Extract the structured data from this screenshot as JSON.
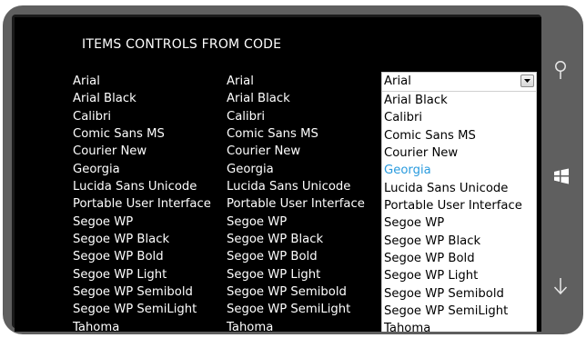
{
  "page_title": "ITEMS CONTROLS FROM CODE",
  "fonts": [
    "Arial",
    "Arial Black",
    "Calibri",
    "Comic Sans MS",
    "Courier New",
    "Georgia",
    "Lucida Sans Unicode",
    "Portable User Interface",
    "Segoe WP",
    "Segoe WP Black",
    "Segoe WP Bold",
    "Segoe WP Light",
    "Segoe WP Semibold",
    "Segoe WP SemiLight",
    "Tahoma"
  ],
  "combo": {
    "selected_value": "Arial",
    "highlighted_item": "Georgia",
    "highlight_color": "#2a9bde"
  },
  "icons": {
    "search": "search-icon",
    "windows": "windows-logo-icon",
    "scroll": "arrow-down-icon"
  }
}
